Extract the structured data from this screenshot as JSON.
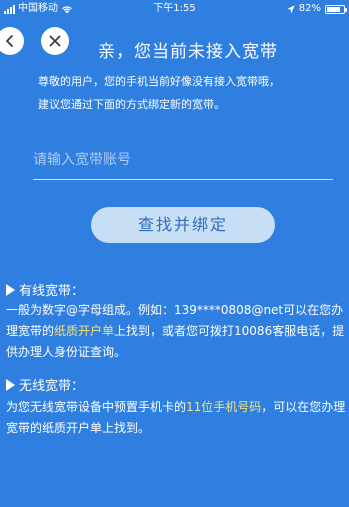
{
  "status_bar": {
    "carrier": "中国移动",
    "time": "下午1:55",
    "battery": "82%",
    "battery_level": 0.82
  },
  "nav": {
    "back_icon": "chevron-left-icon",
    "close_icon": "close-icon"
  },
  "page": {
    "title": "亲，您当前未接入宽带",
    "desc_line1": "尊敬的用户，您的手机当前好像没有接入宽带哦，",
    "desc_line2": "建议您通过下面的方式绑定新的宽带。"
  },
  "form": {
    "account_placeholder": "请输入宽带账号",
    "account_value": "",
    "bind_button": "查找并绑定"
  },
  "wired": {
    "title": "有线宽带：",
    "text_a": "一般为数字@字母组成。例如：139****0808@net可以在您办理宽带的",
    "highlight": "纸质开户单",
    "text_b": "上找到，或者您可拨打10086客服电话，提供办理人身份证查询。"
  },
  "wireless": {
    "title": "无线宽带：",
    "text_a": "为您无线宽带设备中预置手机卡的",
    "highlight": "11位手机号码",
    "text_b": "，可以在您办理宽带的纸质开户单上找到。"
  },
  "colors": {
    "background": "#2f7fe0",
    "button_bg": "#c7def4",
    "button_text": "#2f6fbe",
    "highlight": "#f4e37a"
  }
}
